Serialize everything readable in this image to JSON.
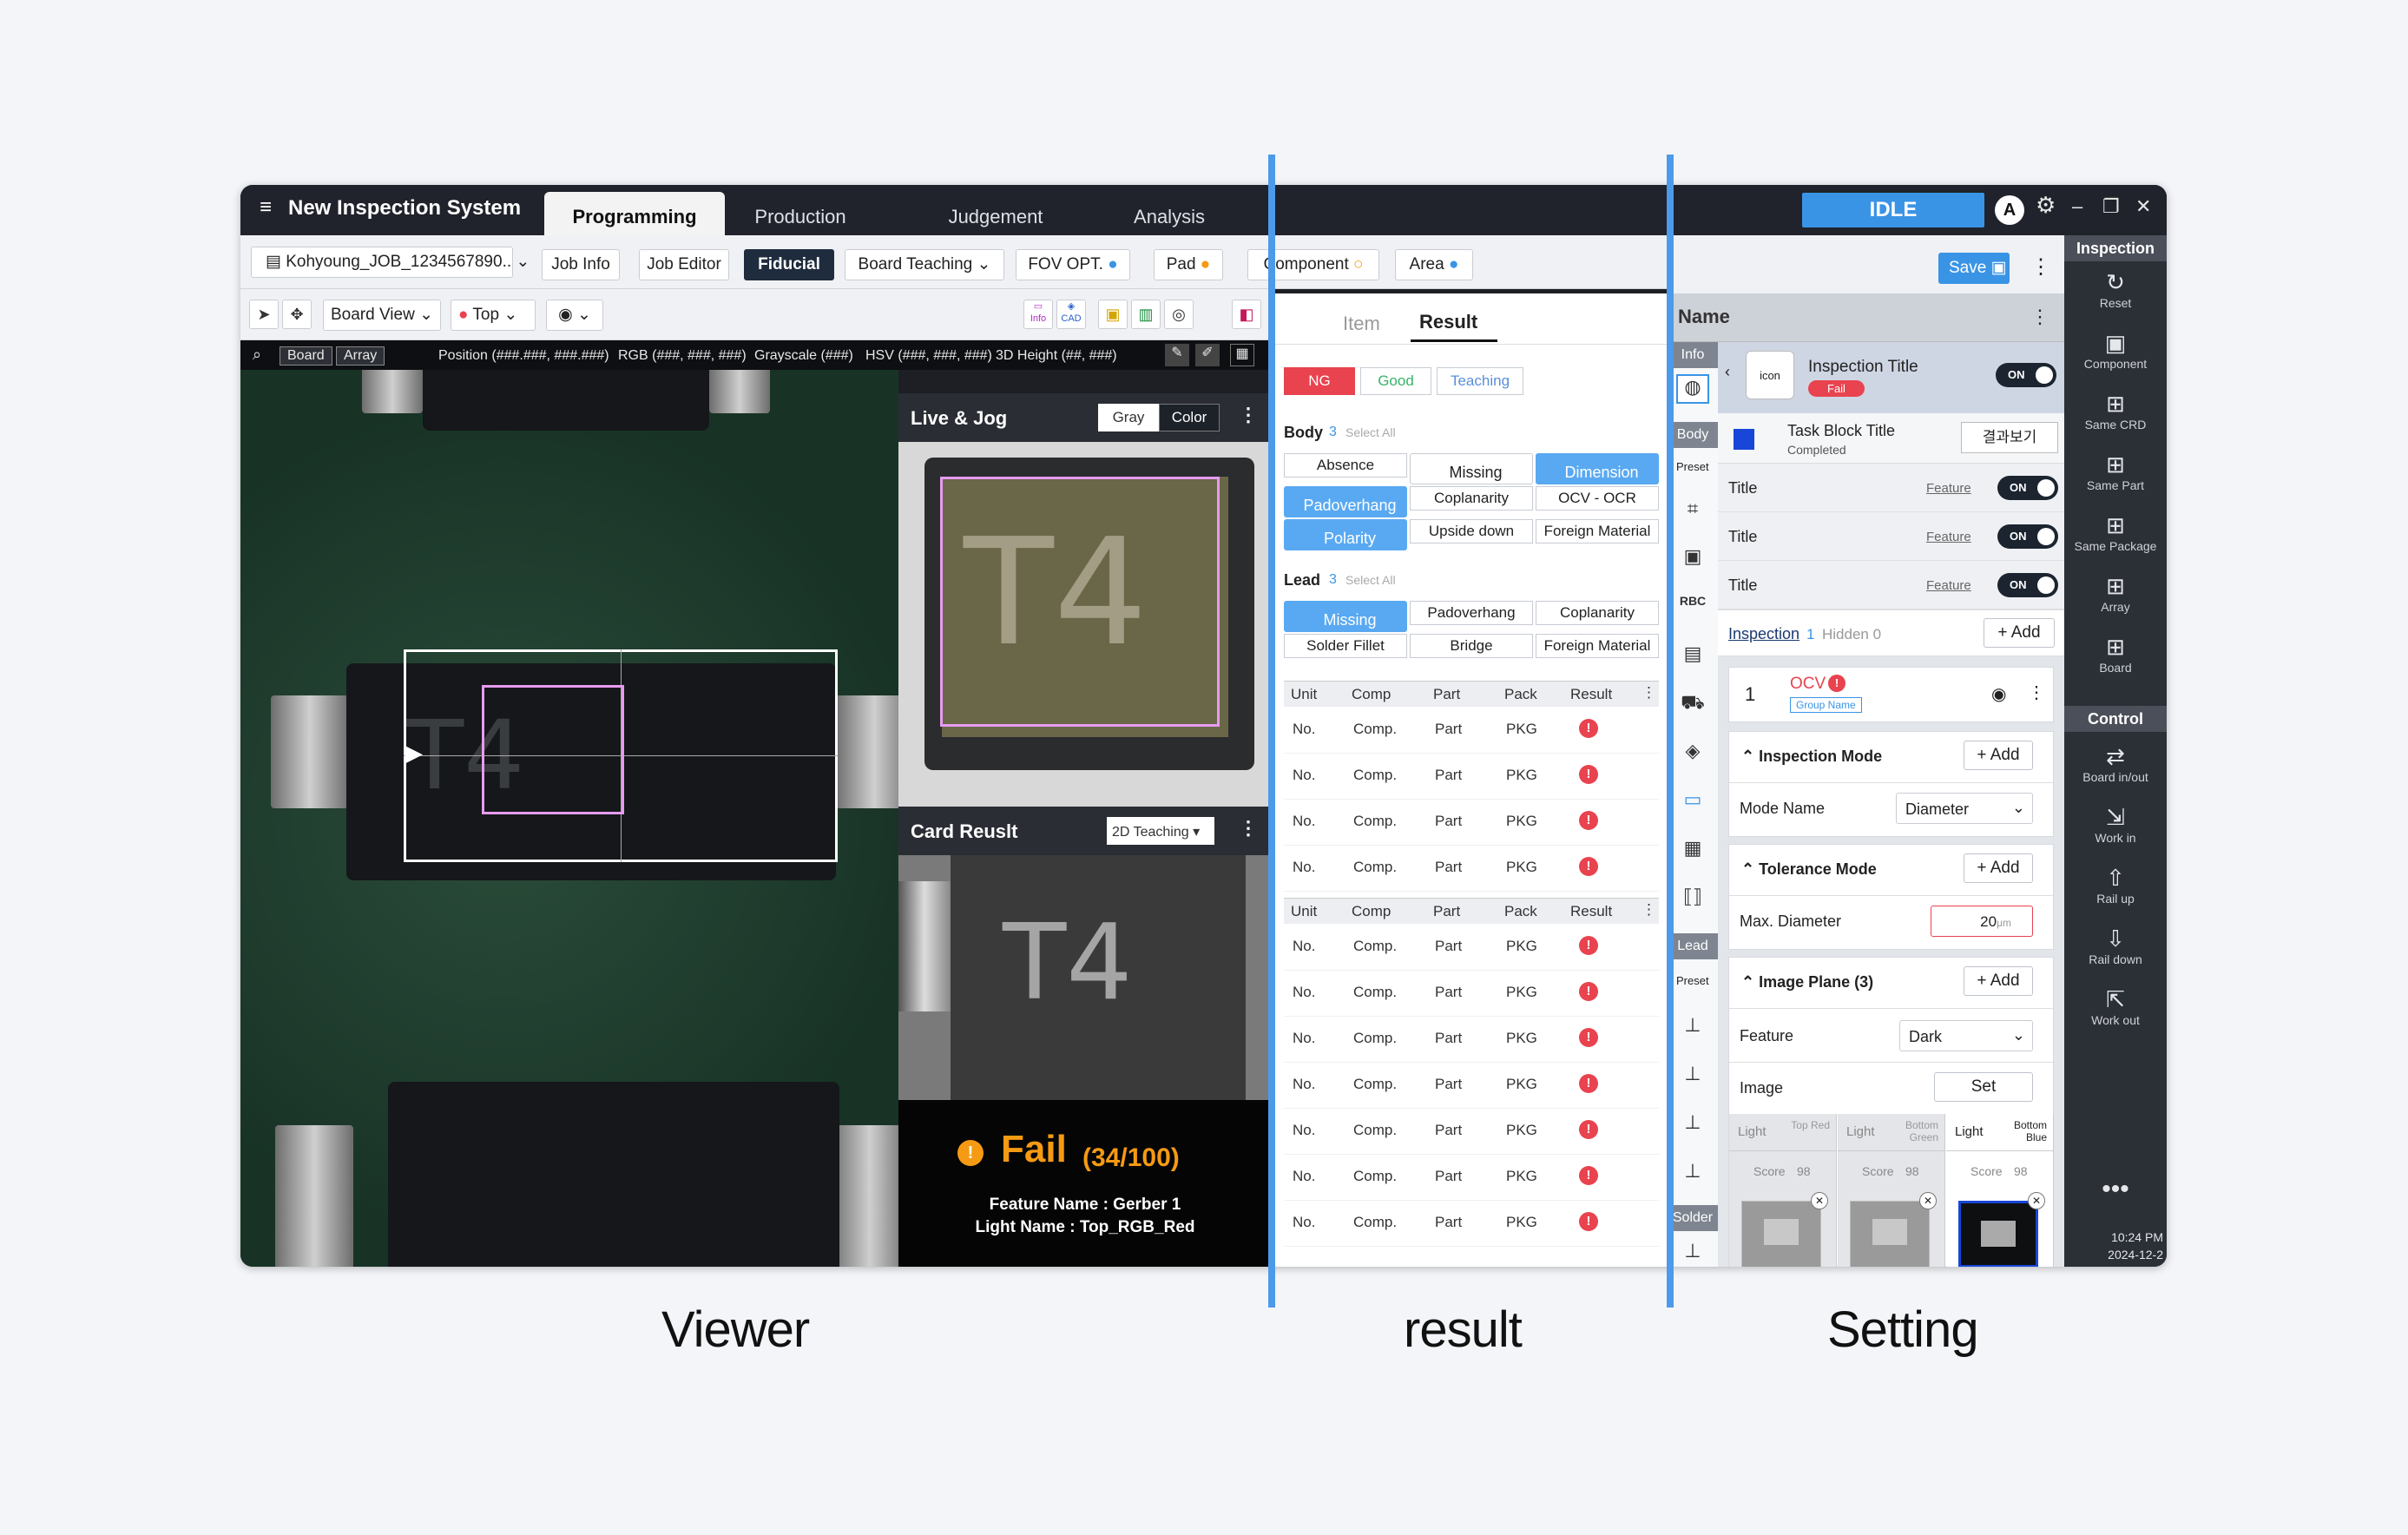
{
  "app": {
    "title": "New Inspection System",
    "menu_icon": "hamburger-icon",
    "tabs": [
      "Programming",
      "Production",
      "Judgement",
      "Analysis"
    ],
    "active_tab": "Programming",
    "status": "IDLE",
    "user_initial": "A"
  },
  "toolbar": {
    "job": "Kohyoung_JOB_1234567890..",
    "job_info": "Job Info",
    "job_editor": "Job Editor",
    "fiducial": "Fiducial",
    "board_teaching": "Board Teaching",
    "fov": "FOV OPT.",
    "pad": "Pad",
    "component": "Component",
    "area": "Area"
  },
  "viewbar": {
    "board_view": "Board View",
    "top": "Top",
    "info": "Info",
    "cad": "CAD"
  },
  "strip": {
    "board": "Board",
    "array": "Array",
    "position": "Position (###.###, ###.###)",
    "rgb": "RGB (###, ###, ###)",
    "gray": "Grayscale (###)",
    "hsv": "HSV (###, ###, ###)",
    "height": "3D Height (##, ###)"
  },
  "live": {
    "title": "Live & Jog",
    "gray": "Gray",
    "color": "Color",
    "chip_text": "T4"
  },
  "card": {
    "title": "Card Reuslt",
    "mode": "2D Teaching",
    "fail": "Fail",
    "score": "(34/100)",
    "feature": "Feature Name : Gerber 1",
    "light": "Light Name : Top_RGB_Red"
  },
  "result": {
    "tab_item": "Item",
    "tab_result": "Result",
    "ng": "NG",
    "good": "Good",
    "teaching": "Teaching",
    "body_label": "Body",
    "body_count": "3",
    "select_all": "Select All",
    "body_items": [
      "Absence",
      "Missing",
      "Dimension",
      "Padoverhang",
      "Coplanarity",
      "OCV - OCR",
      "Polarity",
      "Upside down",
      "Foreign Material"
    ],
    "lead_label": "Lead",
    "lead_count": "3",
    "lead_items": [
      "Missing",
      "Padoverhang",
      "Coplanarity",
      "Solder Fillet",
      "Bridge",
      "Foreign Material"
    ],
    "cols": [
      "Unit",
      "Comp",
      "Part",
      "Pack",
      "Result"
    ],
    "row": [
      "No.",
      "Comp.",
      "Part",
      "PKG"
    ]
  },
  "setting": {
    "name": "Name",
    "info": "Info",
    "body": "Body",
    "lead": "Lead",
    "solder": "Solder",
    "preset": "Preset",
    "insp_title": "Inspection Title",
    "insp_icon": "icon",
    "fail_badge": "Fail",
    "on": "ON",
    "task_title": "Task Block Title",
    "task_status": "Completed",
    "view_result": "결과보기",
    "title": "Title",
    "feature": "Feature",
    "inspection": "Inspection",
    "insp_count": "1",
    "hidden": "Hidden 0",
    "add": "+ Add",
    "idx": "1",
    "ocv": "OCV",
    "group": "Group Name",
    "insp_mode": "Inspection Mode",
    "mode_name": "Mode Name",
    "diameter": "Diameter",
    "tol_mode": "Tolerance Mode",
    "max_dia": "Max. Diameter",
    "max_val": "20",
    "unit": "μm",
    "img_plane": "Image Plane (3)",
    "feature_lbl": "Feature",
    "dark": "Dark",
    "image": "Image",
    "set": "Set",
    "lights": [
      [
        "Light",
        "Top Red"
      ],
      [
        "Light",
        "Bottom Green"
      ],
      [
        "Light",
        "Bottom Blue"
      ]
    ],
    "score": "Score",
    "score_val": "98",
    "save": "Save"
  },
  "rail": {
    "inspection": "Inspection",
    "control": "Control",
    "items": [
      "Reset",
      "Component",
      "Same CRD",
      "Same Part",
      "Same Package",
      "Array",
      "Board"
    ],
    "ctrl": [
      "Board in/out",
      "Work in",
      "Rail up",
      "Rail down",
      "Work out"
    ],
    "time": "10:24 PM",
    "date": "2024-12-2"
  },
  "captions": {
    "viewer": "Viewer",
    "result": "result",
    "setting": "Setting"
  },
  "colors": {
    "accent": "#3a94e6",
    "ng": "#e8434f",
    "fail": "#f59a12",
    "guide": "#4c9aea"
  }
}
